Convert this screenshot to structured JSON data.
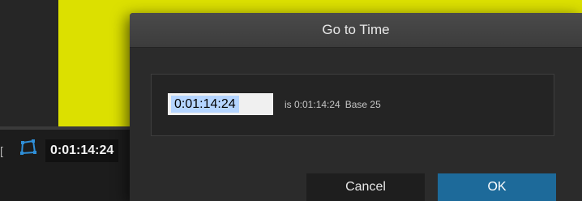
{
  "background": {
    "composition_color": "#dce000",
    "bracket_glyph": "[",
    "mask_icon": "mask-shape-icon",
    "current_time": "0:01:14:24"
  },
  "dialog": {
    "title": "Go to Time",
    "time_input_value": "0:01:14:24",
    "info_text": "is 0:01:14:24",
    "base_text": "Base 25",
    "cancel_label": "Cancel",
    "ok_label": "OK",
    "ok_color": "#1d6a9a"
  }
}
